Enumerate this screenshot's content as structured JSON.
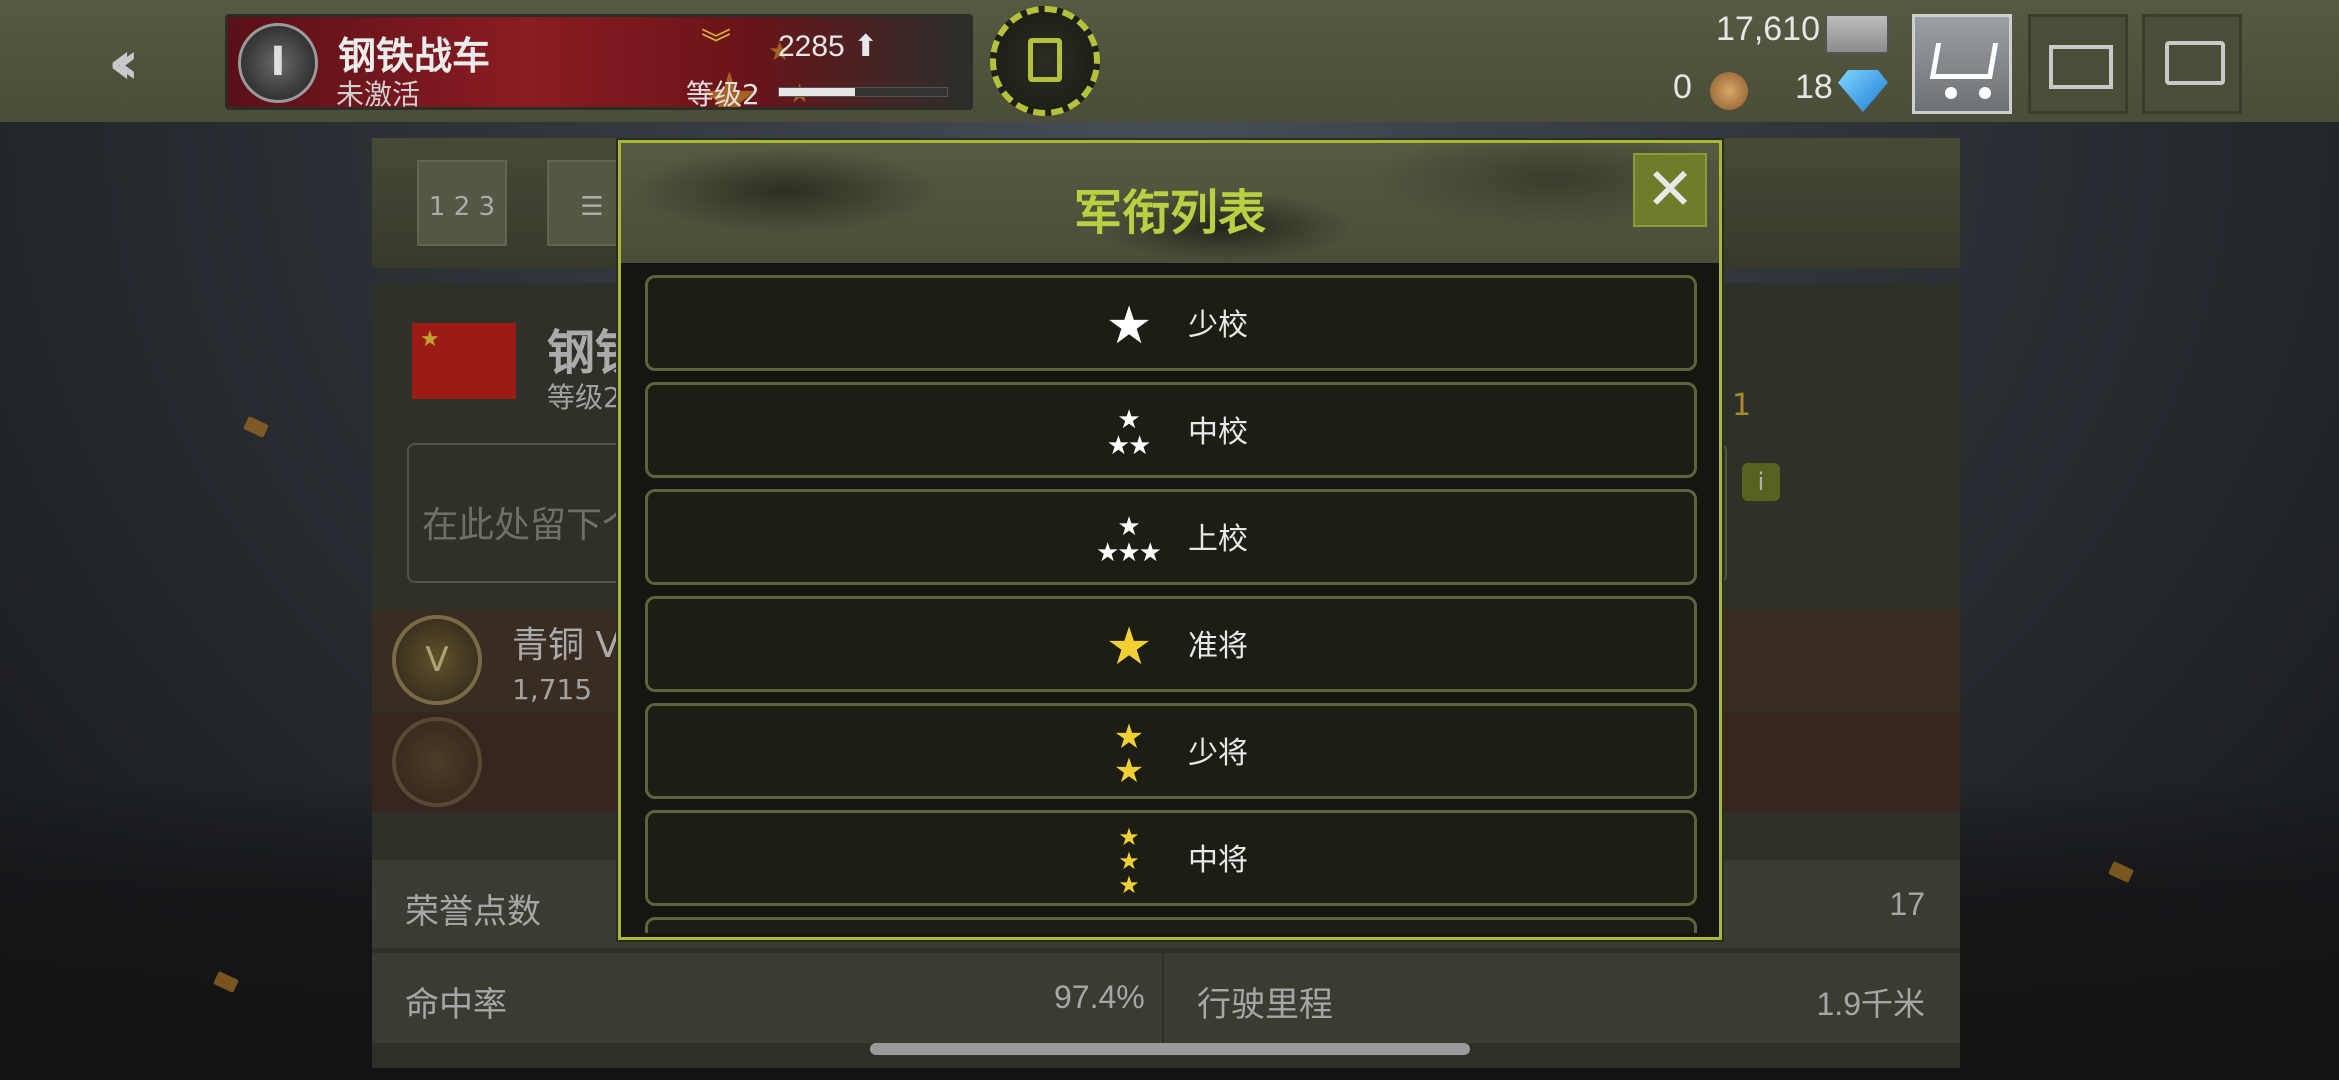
{
  "header": {
    "player_name": "钢铁战车",
    "player_status": "未激活",
    "level_label": "等级2",
    "xp_value": "2285",
    "xp_progress": 0.45
  },
  "currency": {
    "silver": "17,610",
    "medals": "0",
    "gems": "18"
  },
  "icons": {
    "back": "double-chevron-left-icon",
    "rank_emblem": "rank-emblem-icon",
    "fuel": "jerrycan-icon",
    "silver": "banknote-icon",
    "medal": "medal-icon",
    "gem": "diamond-icon",
    "shop": "shopping-cart-icon",
    "mail": "envelope-icon",
    "chat": "chat-bubble-icon",
    "close": "close-icon"
  },
  "background_panel": {
    "player_name": "钢铁",
    "level": "等级2",
    "count": "1",
    "message_placeholder": "在此处留下个",
    "rank_name": "青铜 V",
    "rank_points": "1,715",
    "stats": {
      "honor_label": "荣誉点数",
      "honor_value": "17",
      "accuracy_label": "命中率",
      "accuracy_value": "97.4%",
      "distance_label": "行驶里程",
      "distance_value": "1.9千米"
    }
  },
  "modal": {
    "title": "军衔列表",
    "ranks": [
      {
        "label": "少校",
        "stars": "★",
        "star_count": 1,
        "color": "#ffffff"
      },
      {
        "label": "中校",
        "stars": "★★★",
        "star_count": 3,
        "color": "#ffffff"
      },
      {
        "label": "上校",
        "stars": "★★★★",
        "star_count": 4,
        "color": "#ffffff"
      },
      {
        "label": "准将",
        "stars": "★",
        "star_count": 1,
        "color": "#f2cf34"
      },
      {
        "label": "少将",
        "stars": "★★",
        "star_count": 2,
        "color": "#f2cf34"
      },
      {
        "label": "中将",
        "stars": "★★★",
        "star_count": 3,
        "color": "#f2cf34"
      }
    ]
  },
  "colors": {
    "accent": "#b7d143",
    "gold": "#f2cf34",
    "modal_border": "#a9b63a"
  }
}
